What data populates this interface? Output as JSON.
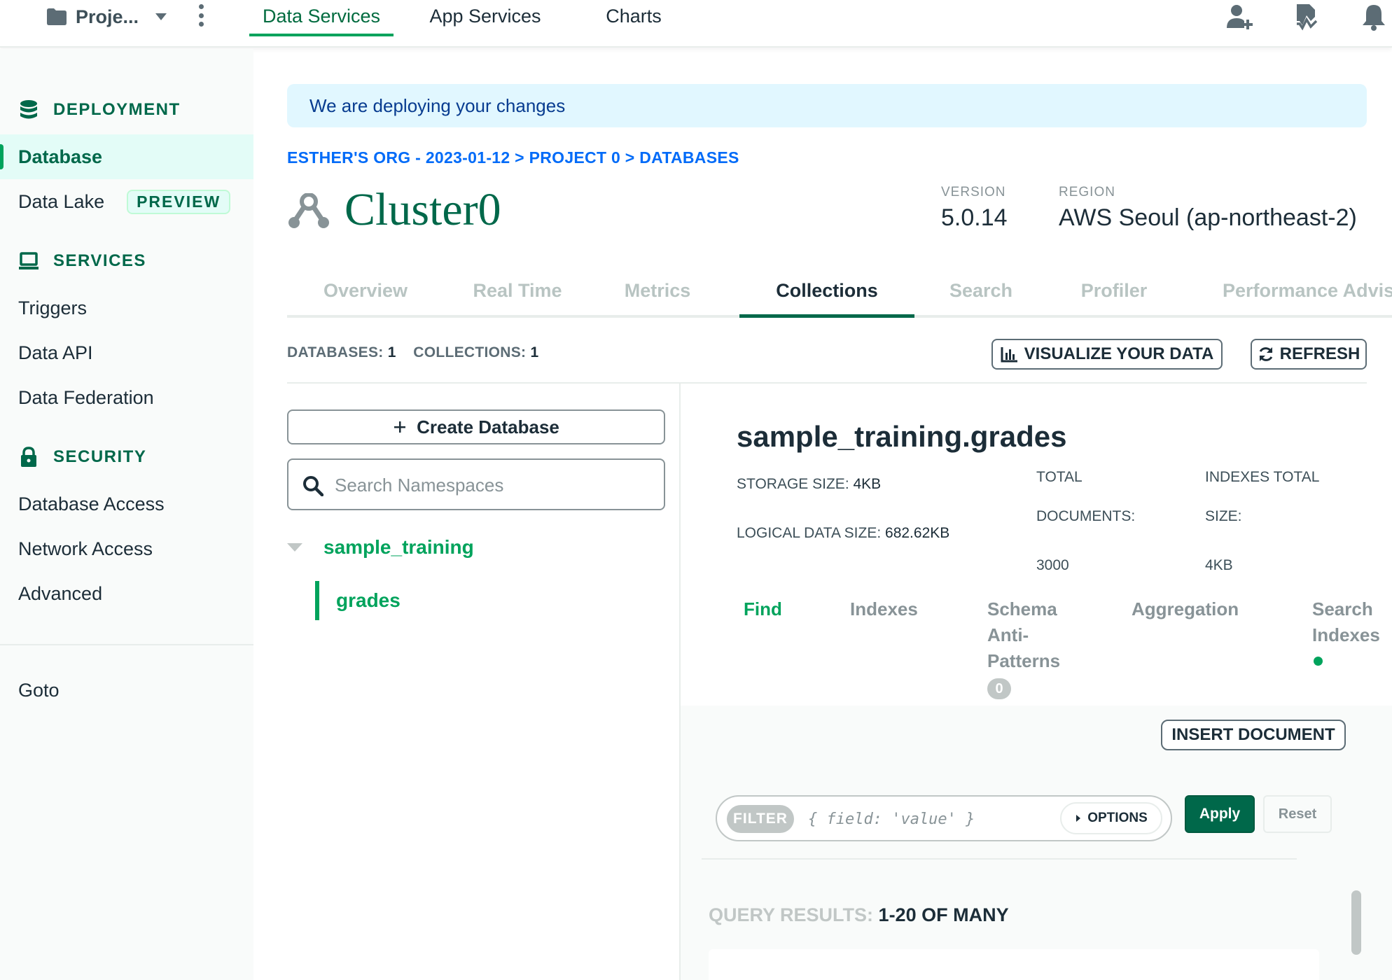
{
  "topnav": {
    "project": "Proje...",
    "tabs": [
      {
        "label": "Data Services",
        "active": true
      },
      {
        "label": "App Services",
        "active": false
      },
      {
        "label": "Charts",
        "active": false
      }
    ],
    "icons": [
      "folder-icon",
      "chevron-down-icon",
      "kebab-menu-icon",
      "invite-user-icon",
      "activity-feed-icon",
      "bell-icon"
    ]
  },
  "sidebar": {
    "sections": [
      {
        "heading": "DEPLOYMENT",
        "icon": "database-stack-icon"
      },
      {
        "heading": "SERVICES",
        "icon": "laptop-icon"
      },
      {
        "heading": "SECURITY",
        "icon": "lock-icon"
      }
    ],
    "items": {
      "database": "Database",
      "data_lake": "Data Lake",
      "preview_badge": "PREVIEW",
      "triggers": "Triggers",
      "data_api": "Data API",
      "data_federation": "Data Federation",
      "database_access": "Database Access",
      "network_access": "Network Access",
      "advanced": "Advanced",
      "goto": "Goto"
    },
    "active_item": "Database"
  },
  "banner": "We are deploying your changes",
  "breadcrumb": "ESTHER'S ORG - 2023-01-12 > PROJECT 0 > DATABASES",
  "cluster": {
    "name": "Cluster0",
    "version_label": "VERSION",
    "version": "5.0.14",
    "region_label": "REGION",
    "region": "AWS Seoul (ap-northeast-2)"
  },
  "cluster_tabs": [
    {
      "label": "Overview",
      "active": false
    },
    {
      "label": "Real Time",
      "active": false
    },
    {
      "label": "Metrics",
      "active": false
    },
    {
      "label": "Collections",
      "active": true
    },
    {
      "label": "Search",
      "active": false
    },
    {
      "label": "Profiler",
      "active": false
    },
    {
      "label": "Performance Advis",
      "active": false
    }
  ],
  "counts": {
    "databases_label": "DATABASES:",
    "databases": "1",
    "collections_label": "COLLECTIONS:",
    "collections": "1"
  },
  "toolbar": {
    "visualize": "VISUALIZE YOUR DATA",
    "refresh": "REFRESH"
  },
  "namespace": {
    "create_db": "Create Database",
    "search_placeholder": "Search Namespaces",
    "database": "sample_training",
    "collection": "grades"
  },
  "collection": {
    "title": "sample_training.grades",
    "storage_size_label": "STORAGE SIZE:",
    "storage_size": "4KB",
    "logical_size_label": "LOGICAL DATA SIZE:",
    "logical_size": "682.62KB",
    "total_docs_label_1": "TOTAL",
    "total_docs_label_2": "DOCUMENTS:",
    "total_docs": "3000",
    "indexes_size_label_1": "INDEXES TOTAL",
    "indexes_size_label_2": "SIZE:",
    "indexes_size": "4KB"
  },
  "collection_tabs": {
    "find": "Find",
    "indexes": "Indexes",
    "schema_1": "Schema",
    "schema_2": "Anti-",
    "schema_3": "Patterns",
    "schema_count": "0",
    "aggregation": "Aggregation",
    "search_1": "Search",
    "search_2": "Indexes",
    "active": "Find"
  },
  "find": {
    "insert": "INSERT DOCUMENT",
    "filter_tag": "FILTER",
    "filter_placeholder": "{ field: 'value' }",
    "options": "OPTIONS",
    "apply": "Apply",
    "reset": "Reset",
    "results_label": "QUERY RESULTS:",
    "results_value": "1-20 OF MANY"
  },
  "colors": {
    "brand_green": "#00684a",
    "accent_green": "#00a35c",
    "link_blue": "#016bf8",
    "banner_bg": "#e1f7ff"
  }
}
